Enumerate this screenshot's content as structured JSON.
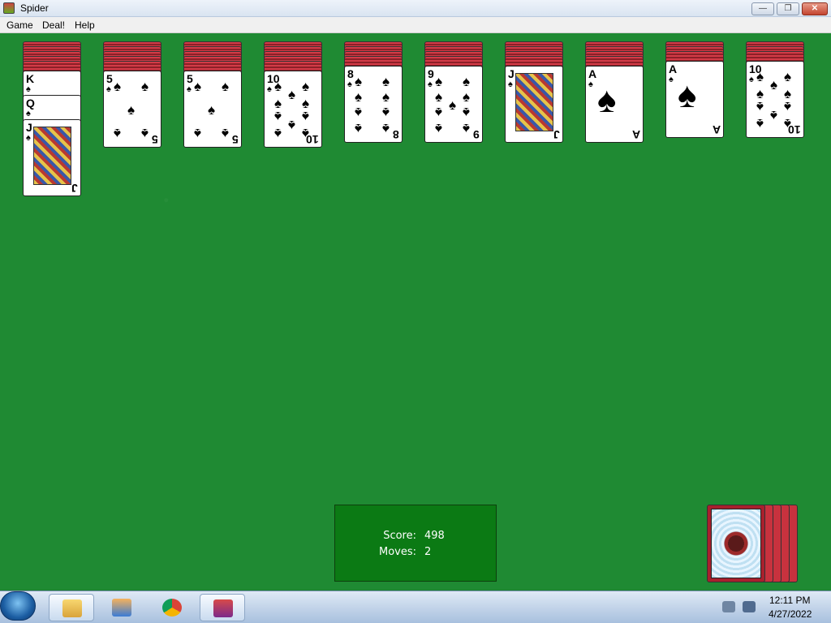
{
  "window": {
    "title": "Spider",
    "min_label": "—",
    "max_label": "❐",
    "close_label": "✕"
  },
  "menu": {
    "items": [
      "Game",
      "Deal!",
      "Help"
    ]
  },
  "tableau": [
    {
      "hidden": 5,
      "face_up": [
        {
          "rank": "K",
          "suit": "♠"
        },
        {
          "rank": "Q",
          "suit": "♠"
        },
        {
          "rank": "J",
          "suit": "♠"
        }
      ]
    },
    {
      "hidden": 5,
      "face_up": [
        {
          "rank": "5",
          "suit": "♠"
        }
      ]
    },
    {
      "hidden": 5,
      "face_up": [
        {
          "rank": "5",
          "suit": "♠"
        }
      ]
    },
    {
      "hidden": 5,
      "face_up": [
        {
          "rank": "10",
          "suit": "♠"
        }
      ]
    },
    {
      "hidden": 4,
      "face_up": [
        {
          "rank": "8",
          "suit": "♠"
        }
      ]
    },
    {
      "hidden": 4,
      "face_up": [
        {
          "rank": "9",
          "suit": "♠"
        }
      ]
    },
    {
      "hidden": 4,
      "face_up": [
        {
          "rank": "J",
          "suit": "♠"
        }
      ]
    },
    {
      "hidden": 4,
      "face_up": [
        {
          "rank": "A",
          "suit": "♠"
        }
      ]
    },
    {
      "hidden": 3,
      "face_up": [
        {
          "rank": "A",
          "suit": "♠"
        }
      ]
    },
    {
      "hidden": 3,
      "face_up": [
        {
          "rank": "10",
          "suit": "♠"
        }
      ]
    }
  ],
  "status": {
    "score_label": "Score:",
    "score": "498",
    "moves_label": "Moves:",
    "moves": "2"
  },
  "stock": {
    "piles": 5
  },
  "taskbar": {
    "time": "12:11 PM",
    "date": "4/27/2022"
  },
  "colors": {
    "felt": "#1f8a33",
    "card_back": "#c8323e",
    "score_box": "#0b7a14"
  }
}
